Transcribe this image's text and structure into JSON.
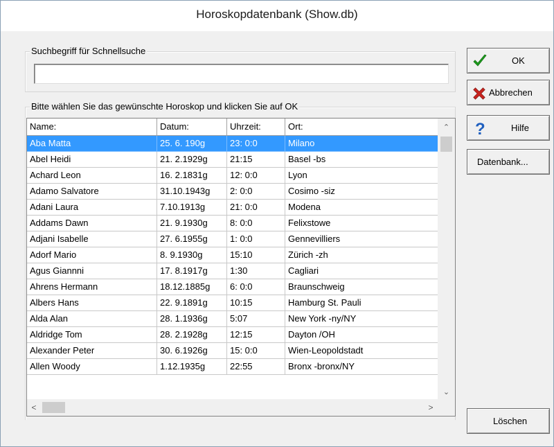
{
  "window": {
    "title": "Horoskopdatenbank (Show.db)"
  },
  "search": {
    "group_label": "Suchbegriff für Schnellsuche",
    "value": "",
    "placeholder": ""
  },
  "list": {
    "group_label": "Bitte wählen Sie das gewünschte Horoskop und klicken Sie auf OK",
    "columns": [
      "Name:",
      "Datum:",
      "Uhrzeit:",
      "Ort:"
    ],
    "rows": [
      [
        "Aba Matta",
        "25. 6. 190g",
        "23: 0:0",
        "Milano"
      ],
      [
        "Abel Heidi",
        "21. 2.1929g",
        "21:15",
        "Basel -bs"
      ],
      [
        "Achard Leon",
        "16. 2.1831g",
        "12: 0:0",
        "Lyon"
      ],
      [
        "Adamo Salvatore",
        "31.10.1943g",
        "2: 0:0",
        "Cosimo -siz"
      ],
      [
        "Adani Laura",
        "7.10.1913g",
        "21: 0:0",
        "Modena"
      ],
      [
        "Addams Dawn",
        "21. 9.1930g",
        "8: 0:0",
        "Felixstowe"
      ],
      [
        "Adjani Isabelle",
        "27. 6.1955g",
        "1: 0:0",
        "Gennevilliers"
      ],
      [
        "Adorf Mario",
        "8. 9.1930g",
        "15:10",
        "Zürich -zh"
      ],
      [
        "Agus Giannni",
        "17. 8.1917g",
        "1:30",
        "Cagliari"
      ],
      [
        "Ahrens Hermann",
        "18.12.1885g",
        "6: 0:0",
        "Braunschweig"
      ],
      [
        "Albers Hans",
        "22. 9.1891g",
        "10:15",
        "Hamburg St. Pauli"
      ],
      [
        "Alda Alan",
        "28. 1.1936g",
        "5:07",
        "New York -ny/NY"
      ],
      [
        "Aldridge Tom",
        "28. 2.1928g",
        "12:15",
        "Dayton /OH"
      ],
      [
        "Alexander Peter",
        "30. 6.1926g",
        "15: 0:0",
        "Wien-Leopoldstadt"
      ],
      [
        "Allen Woody",
        "1.12.1935g",
        "22:55",
        "Bronx -bronx/NY"
      ]
    ],
    "selected_index": 0
  },
  "buttons": {
    "ok": "OK",
    "cancel": "Abbrechen",
    "help": "Hilfe",
    "database": "Datenbank...",
    "delete": "Löschen"
  },
  "colors": {
    "selection": "#3399ff",
    "ok_icon": "#1e9e1e",
    "cancel_icon": "#c8231e",
    "help_icon": "#1f5fbf"
  }
}
